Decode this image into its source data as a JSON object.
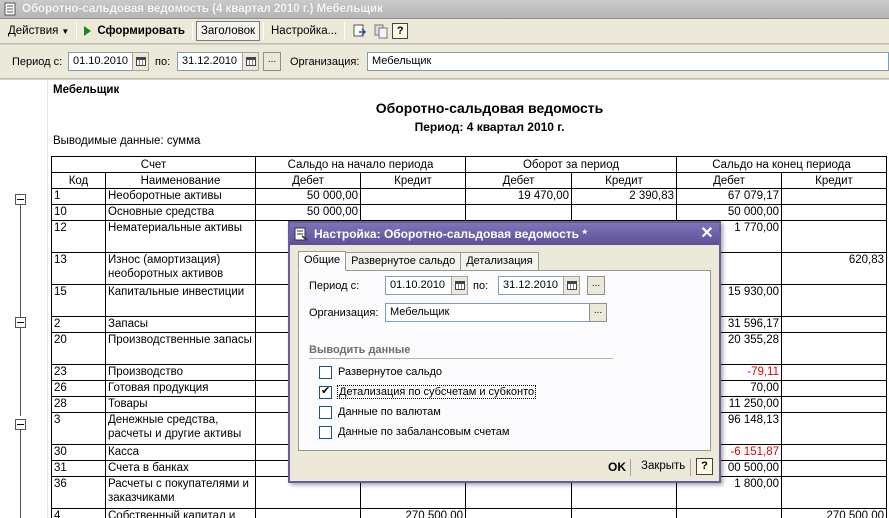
{
  "window": {
    "title": "Оборотно-сальдовая ведомость (4 квартал 2010 г.) Мебельщик"
  },
  "toolbar": {
    "actions_label": "Действия",
    "generate_label": "Сформировать",
    "header_label": "Заголовок",
    "settings_label": "Настройка...",
    "help_label": "?"
  },
  "period": {
    "from_label": "Период с:",
    "from_value": "01.10.2010",
    "to_label": "по:",
    "to_value": "31.12.2010",
    "dots_label": "...",
    "org_label": "Организация:",
    "org_value": "Мебельщик"
  },
  "report": {
    "org_name": "Мебельщик",
    "title": "Оборотно-сальдовая ведомость",
    "period_line": "Период: 4 квартал 2010 г.",
    "output_line": "Выводимые данные: сумма",
    "header": {
      "account": "Счет",
      "opening": "Сальдо на начало периода",
      "turnover": "Оборот за период",
      "closing": "Сальдо на конец периода",
      "code": "Код",
      "name": "Наименование",
      "debit": "Дебет",
      "credit": "Кредит"
    },
    "rows": [
      {
        "code": "1",
        "name": "Необоротные активы",
        "od": "50 000,00",
        "oc": "",
        "td": "19 470,00",
        "tc": "2 390,83",
        "cd": "67 079,17",
        "cc": ""
      },
      {
        "code": "10",
        "name": "Основные средства",
        "od": "50 000,00",
        "oc": "",
        "td": "",
        "tc": "",
        "cd": "50 000,00",
        "cc": ""
      },
      {
        "code": "12",
        "name": "Нематериальные активы",
        "od": "",
        "oc": "",
        "td": "",
        "tc": "",
        "cd": "1 770,00",
        "cc": ""
      },
      {
        "code": "13",
        "name": "Износ (амортизация) необоротных активов",
        "od": "",
        "oc": "",
        "td": "",
        "tc": "",
        "cd": "",
        "cc": "620,83"
      },
      {
        "code": "15",
        "name": "Капитальные инвестиции",
        "od": "",
        "oc": "",
        "td": "",
        "tc": "",
        "cd": "15 930,00",
        "cc": ""
      },
      {
        "code": "2",
        "name": "Запасы",
        "od": "",
        "oc": "",
        "td": "",
        "tc": "",
        "cd": "31 596,17",
        "cc": ""
      },
      {
        "code": "20",
        "name": "Производственные запасы",
        "od": "",
        "oc": "",
        "td": "",
        "tc": "",
        "cd": "20 355,28",
        "cc": ""
      },
      {
        "code": "23",
        "name": "Производство",
        "od": "",
        "oc": "",
        "td": "",
        "tc": "",
        "cd": "-79,11",
        "cc": ""
      },
      {
        "code": "26",
        "name": "Готовая продукция",
        "od": "",
        "oc": "",
        "td": "",
        "tc": "",
        "cd": "70,00",
        "cc": ""
      },
      {
        "code": "28",
        "name": "Товары",
        "od": "",
        "oc": "",
        "td": "",
        "tc": "",
        "cd": "11 250,00",
        "cc": ""
      },
      {
        "code": "3",
        "name": "Денежные средства, расчеты и другие активы",
        "od": "",
        "oc": "",
        "td": "",
        "tc": "",
        "cd": "96 148,13",
        "cc": ""
      },
      {
        "code": "30",
        "name": "Касса",
        "od": "",
        "oc": "",
        "td": "",
        "tc": "",
        "cd": "-6 151,87",
        "cc": ""
      },
      {
        "code": "31",
        "name": "Счета в банках",
        "od": "",
        "oc": "",
        "td": "",
        "tc": "",
        "cd": "00 500,00",
        "cc": ""
      },
      {
        "code": "36",
        "name": "Расчеты с покупателями и заказчиками",
        "od": "",
        "oc": "",
        "td": "",
        "tc": "",
        "cd": "1 800,00",
        "cc": ""
      },
      {
        "code": "4",
        "name": "Собственный капитал и",
        "od": "",
        "oc": "270 500,00",
        "td": "",
        "tc": "",
        "cd": "",
        "cc": "270 500,00"
      }
    ]
  },
  "dialog": {
    "title": "Настройка: Оборотно-сальдовая ведомость *",
    "close_glyph": "✕",
    "tabs": [
      "Общие",
      "Развернутое сальдо",
      "Детализация"
    ],
    "from_label": "Период с:",
    "from_value": "01.10.2010",
    "to_label": "по:",
    "to_value": "31.12.2010",
    "org_label": "Организация:",
    "org_value": "Мебельщик",
    "dots_label": "...",
    "section_output": "Выводить данные",
    "checkboxes": [
      {
        "label": "Развернутое сальдо",
        "checked": false
      },
      {
        "label": "Детализация по субсчетам и субконто",
        "checked": true
      },
      {
        "label": "Данные по валютам",
        "checked": false
      },
      {
        "label": "Данные по забалансовым счетам",
        "checked": false
      }
    ],
    "ok_label": "OK",
    "close_label": "Закрыть",
    "help_label": "?"
  },
  "colors": {
    "dialog_title": "#5c4f98",
    "negative_value": "#e00000",
    "generate_icon": "#1a8a1a"
  }
}
